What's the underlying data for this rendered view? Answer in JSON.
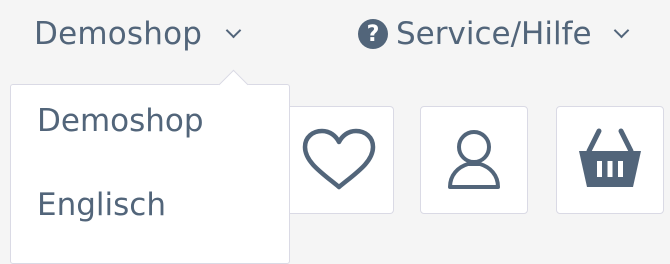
{
  "header": {
    "shop_switcher": {
      "label": "Demoshop"
    },
    "service_menu": {
      "label": "Service/Hilfe",
      "icon_glyph": "?"
    }
  },
  "shop_dropdown": {
    "items": [
      {
        "label": "Demoshop"
      },
      {
        "label": "Englisch"
      }
    ]
  },
  "actions": {
    "icons": [
      "heart-icon",
      "user-icon",
      "basket-icon"
    ]
  },
  "colors": {
    "text": "#52657a",
    "background": "#f5f5f5",
    "border": "#dadae5"
  }
}
